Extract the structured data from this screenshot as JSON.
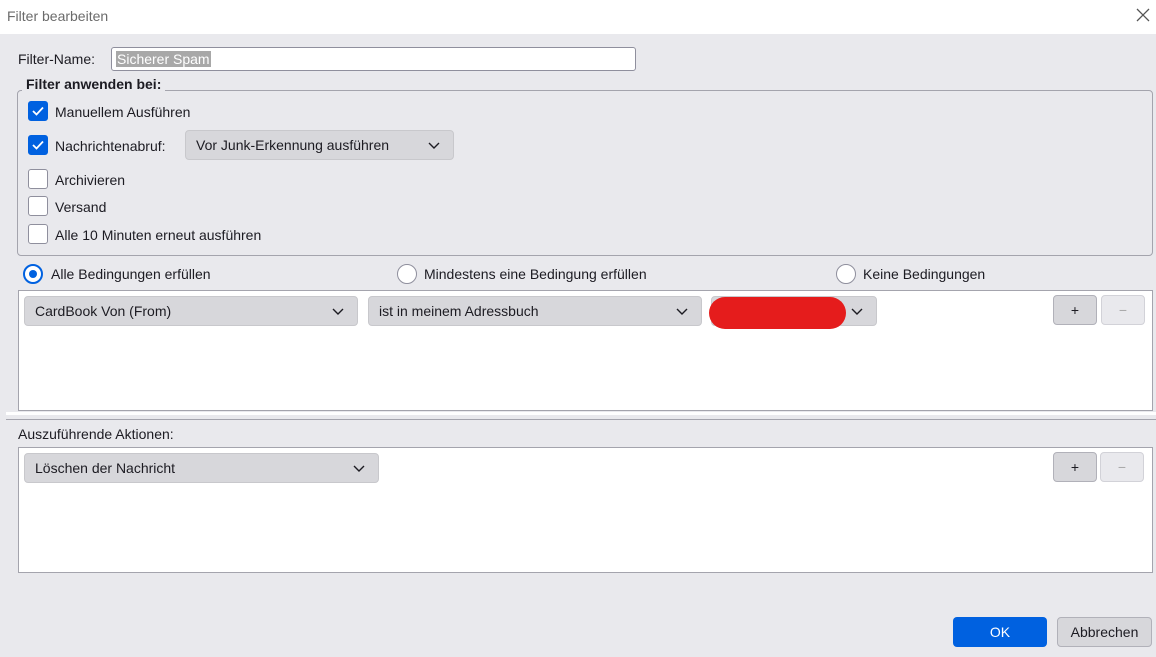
{
  "window": {
    "title": "Filter bearbeiten"
  },
  "filter_name": {
    "label": "Filter-Name:",
    "value": "Sicherer Spam"
  },
  "apply_section": {
    "legend": "Filter anwenden bei:",
    "options": [
      {
        "label": "Manuellem Ausführen",
        "checked": true
      },
      {
        "label": "Nachrichtenabruf:",
        "checked": true
      },
      {
        "label": "Archivieren",
        "checked": false
      },
      {
        "label": "Versand",
        "checked": false
      },
      {
        "label": "Alle 10 Minuten erneut ausführen",
        "checked": false
      }
    ],
    "fetch_dropdown": "Vor Junk-Erkennung ausführen"
  },
  "match": {
    "options": [
      {
        "label": "Alle Bedingungen erfüllen",
        "selected": true
      },
      {
        "label": "Mindestens eine Bedingung erfüllen",
        "selected": false
      },
      {
        "label": "Keine Bedingungen",
        "selected": false
      }
    ]
  },
  "condition": {
    "field": "CardBook Von (From)",
    "operator": "ist in meinem Adressbuch",
    "add": "+",
    "remove": "−"
  },
  "actions": {
    "label": "Auszuführende Aktionen:",
    "action": "Löschen der Nachricht",
    "add": "+",
    "remove": "−"
  },
  "buttons": {
    "ok": "OK",
    "cancel": "Abbrechen"
  },
  "colors": {
    "accent": "#0061e0",
    "redaction": "#e51c1c"
  }
}
